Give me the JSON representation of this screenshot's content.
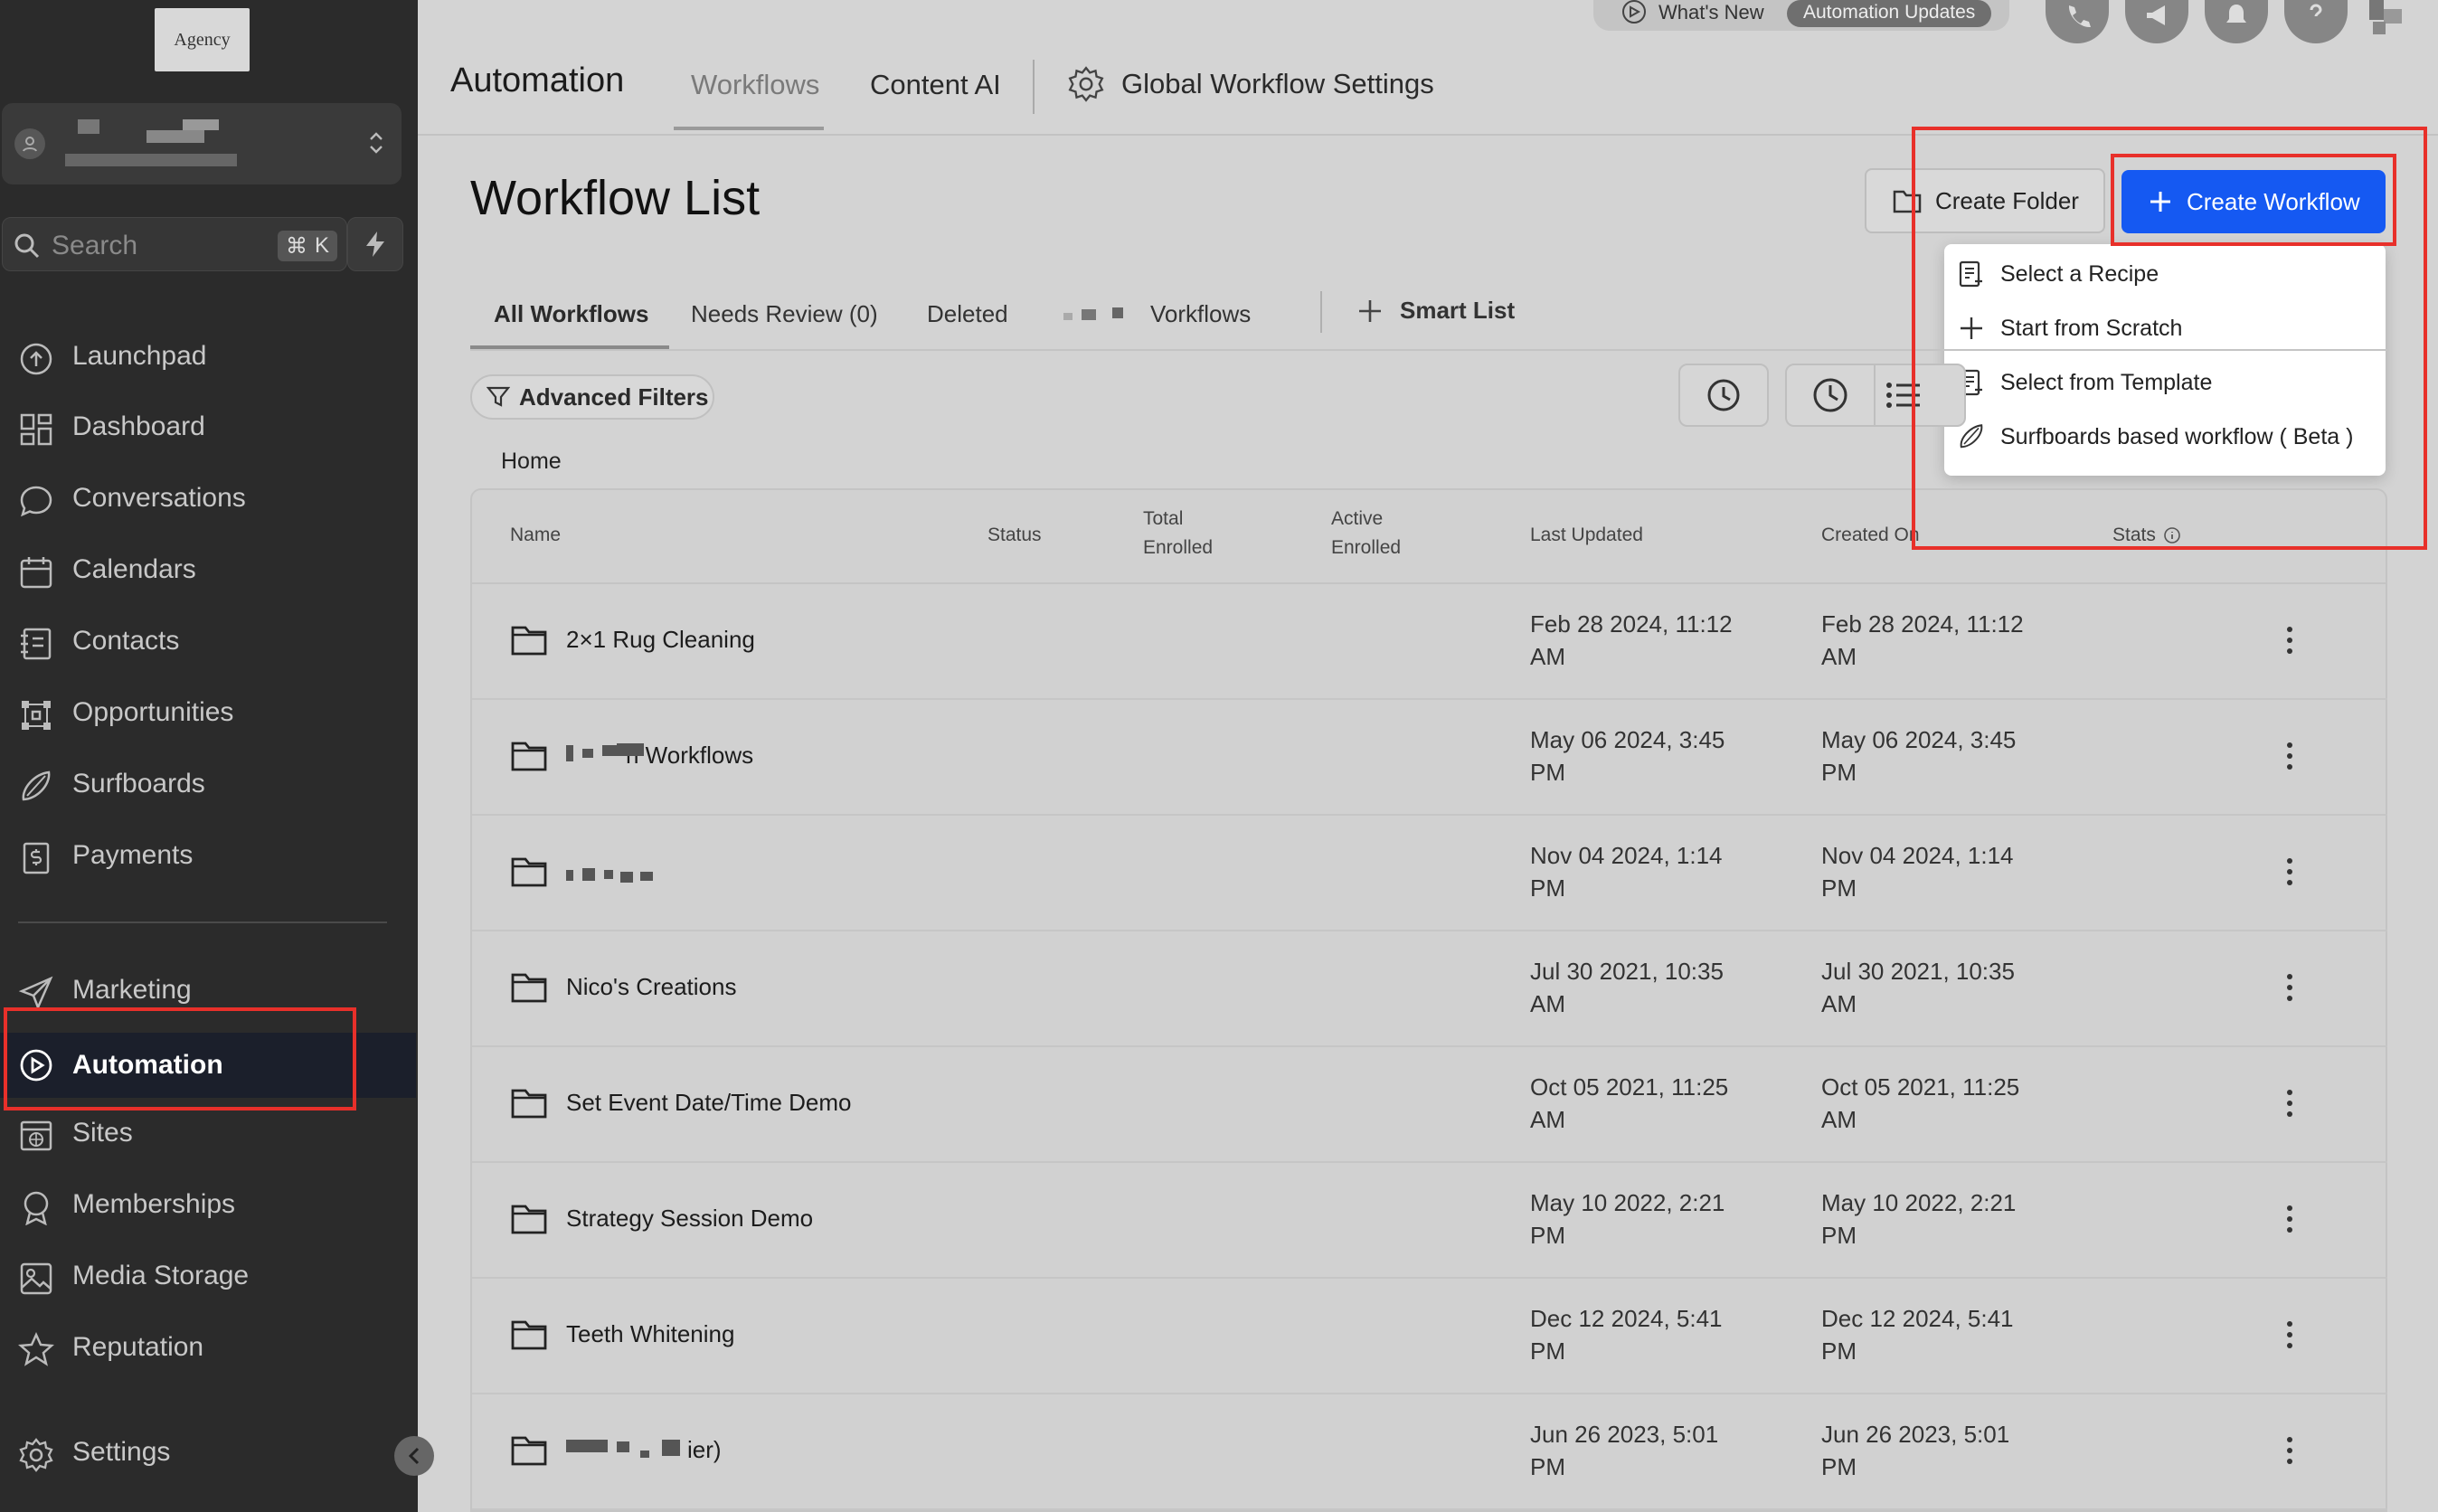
{
  "sidebar": {
    "logo_text": "Agency",
    "search_placeholder": "Search",
    "search_shortcut": "K",
    "items": [
      {
        "label": "Launchpad",
        "icon": "launchpad-icon"
      },
      {
        "label": "Dashboard",
        "icon": "dashboard-icon"
      },
      {
        "label": "Conversations",
        "icon": "chat-bubble-icon"
      },
      {
        "label": "Calendars",
        "icon": "calendar-icon"
      },
      {
        "label": "Contacts",
        "icon": "contacts-icon"
      },
      {
        "label": "Opportunities",
        "icon": "opportunities-icon"
      },
      {
        "label": "Surfboards",
        "icon": "surfboard-icon"
      },
      {
        "label": "Payments",
        "icon": "payments-icon"
      }
    ],
    "items2": [
      {
        "label": "Marketing",
        "icon": "send-icon"
      },
      {
        "label": "Automation",
        "icon": "automation-icon",
        "active": true
      },
      {
        "label": "Sites",
        "icon": "sites-icon"
      },
      {
        "label": "Memberships",
        "icon": "memberships-icon"
      },
      {
        "label": "Media Storage",
        "icon": "image-icon"
      },
      {
        "label": "Reputation",
        "icon": "star-icon"
      }
    ],
    "settings_label": "Settings"
  },
  "topbar": {
    "title": "Automation",
    "tabs": [
      "Workflows",
      "Content AI"
    ],
    "active_tab": "Workflows",
    "global_settings": "Global Workflow Settings",
    "whats_new": "What's New",
    "automation_updates": "Automation Updates"
  },
  "main": {
    "title": "Workflow List",
    "create_folder": "Create Folder",
    "create_workflow": "Create Workflow",
    "create_menu": [
      "Select a Recipe",
      "Start from Scratch",
      "Select from Template",
      "Surfboards based workflow ( Beta )"
    ],
    "subtabs": [
      "All Workflows",
      "Needs Review (0)",
      "Deleted",
      "Vorkflows"
    ],
    "smart_list": "Smart List",
    "advanced_filters": "Advanced Filters",
    "breadcrumb": "Home"
  },
  "table": {
    "columns": {
      "name": "Name",
      "status": "Status",
      "total_enrolled_1": "Total",
      "total_enrolled_2": "Enrolled",
      "active_enrolled_1": "Active",
      "active_enrolled_2": "Enrolled",
      "last_updated": "Last Updated",
      "created_on": "Created On",
      "stats": "Stats"
    },
    "rows": [
      {
        "name": "2×1 Rug Cleaning",
        "updated_1": "Feb 28 2024, 11:12",
        "updated_2": "AM",
        "created_1": "Feb 28 2024, 11:12",
        "created_2": "AM"
      },
      {
        "name": "n Workflows",
        "updated_1": "May 06 2024, 3:45",
        "updated_2": "PM",
        "created_1": "May 06 2024, 3:45",
        "created_2": "PM"
      },
      {
        "name": "",
        "updated_1": "Nov 04 2024, 1:14",
        "updated_2": "PM",
        "created_1": "Nov 04 2024, 1:14",
        "created_2": "PM"
      },
      {
        "name": "Nico's Creations",
        "updated_1": "Jul 30 2021, 10:35",
        "updated_2": "AM",
        "created_1": "Jul 30 2021, 10:35",
        "created_2": "AM"
      },
      {
        "name": "Set Event Date/Time Demo",
        "updated_1": "Oct 05 2021, 11:25",
        "updated_2": "AM",
        "created_1": "Oct 05 2021, 11:25",
        "created_2": "AM"
      },
      {
        "name": "Strategy Session Demo",
        "updated_1": "May 10 2022, 2:21",
        "updated_2": "PM",
        "created_1": "May 10 2022, 2:21",
        "created_2": "PM"
      },
      {
        "name": "Teeth Whitening",
        "updated_1": "Dec 12 2024, 5:41",
        "updated_2": "PM",
        "created_1": "Dec 12 2024, 5:41",
        "created_2": "PM"
      },
      {
        "name": "ier)",
        "updated_1": "Jun 26 2023, 5:01",
        "updated_2": "PM",
        "created_1": "Jun 26 2023, 5:01",
        "created_2": "PM"
      }
    ]
  },
  "colors": {
    "accent": "#1559f2",
    "highlight": "#e8302a",
    "sidebar_bg": "#2b2b2b",
    "active_bg": "#1b1f2b"
  }
}
